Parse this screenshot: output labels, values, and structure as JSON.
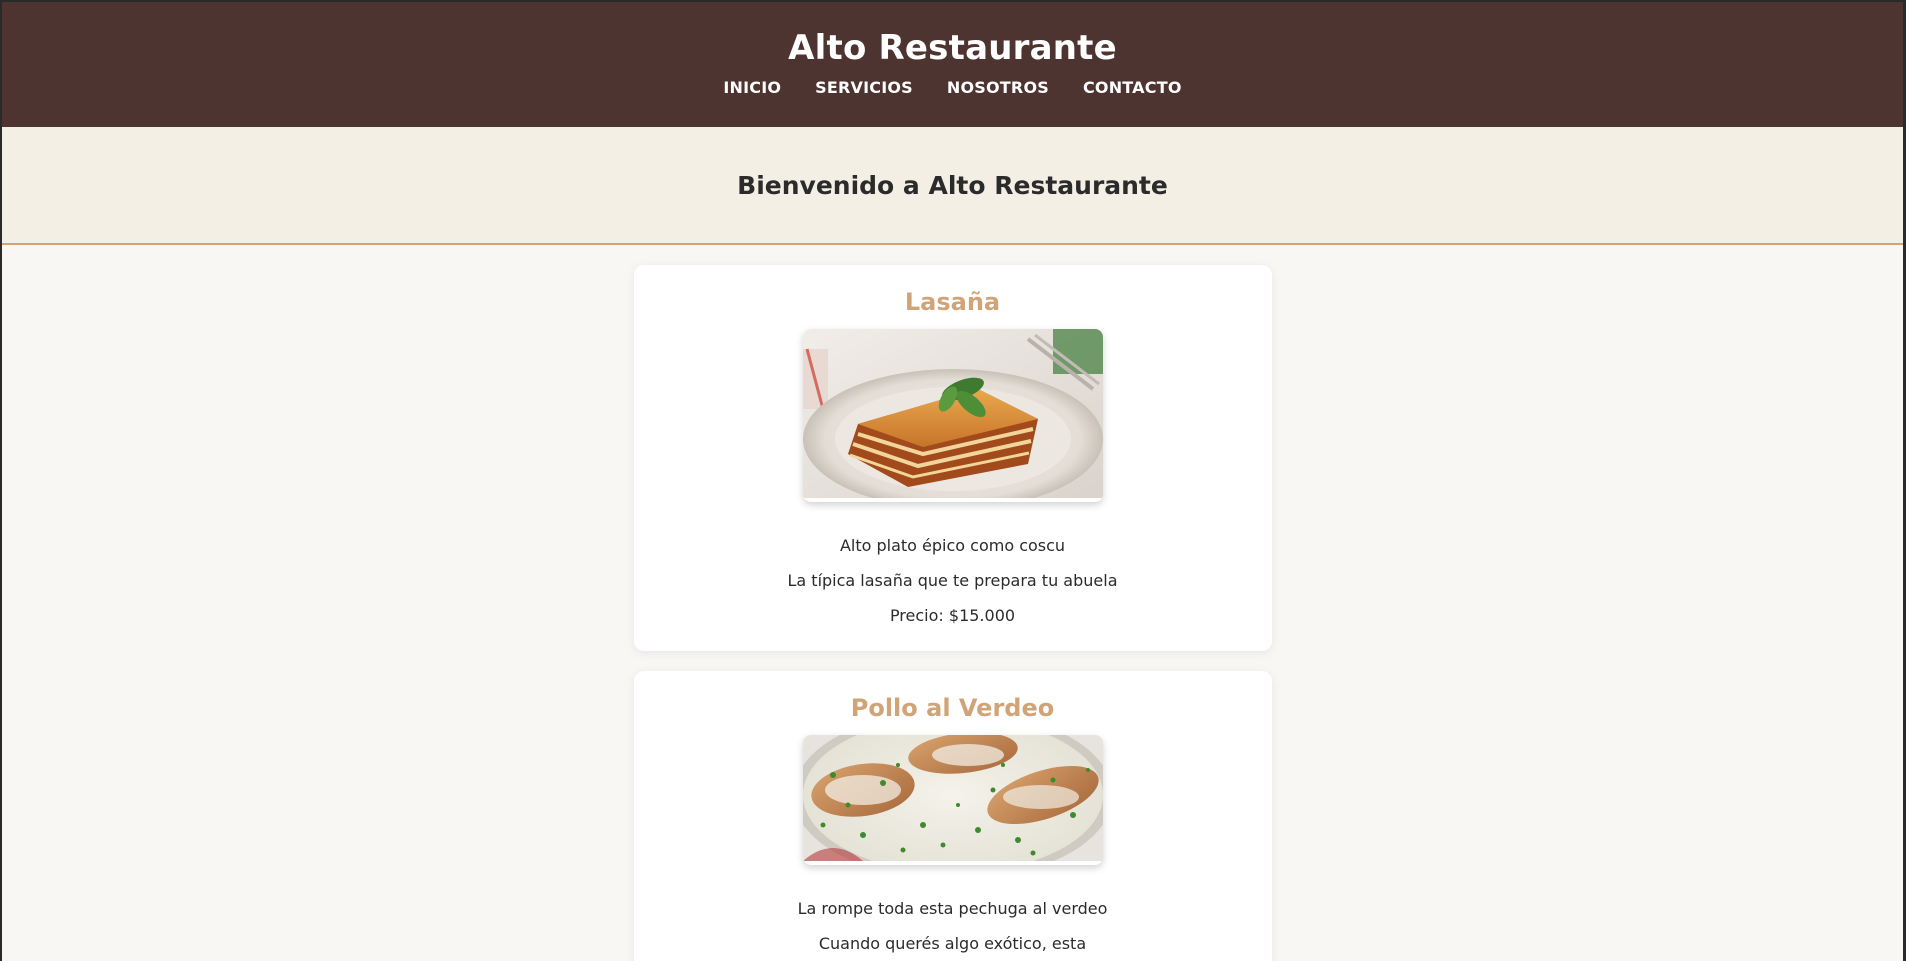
{
  "header": {
    "title": "Alto Restaurante",
    "nav": [
      {
        "label": "INICIO"
      },
      {
        "label": "SERVICIOS"
      },
      {
        "label": "NOSOTROS"
      },
      {
        "label": "CONTACTO"
      }
    ]
  },
  "hero": {
    "heading": "Bienvenido a Alto Restaurante"
  },
  "menu": {
    "items": [
      {
        "name": "Lasaña",
        "image": "lasagna-photo",
        "lines": [
          "Alto plato épico como coscu",
          "La típica lasaña que te prepara tu abuela",
          "Precio: $15.000"
        ]
      },
      {
        "name": "Pollo al Verdeo",
        "image": "chicken-verdeo-photo",
        "lines": [
          "La rompe toda esta pechuga al verdeo",
          "Cuando querés algo exótico, esta"
        ]
      }
    ]
  },
  "colors": {
    "header_bg": "#4e3430",
    "accent": "#d1a477",
    "hero_bg": "#f4efe5",
    "page_bg": "#f9f7f3"
  }
}
